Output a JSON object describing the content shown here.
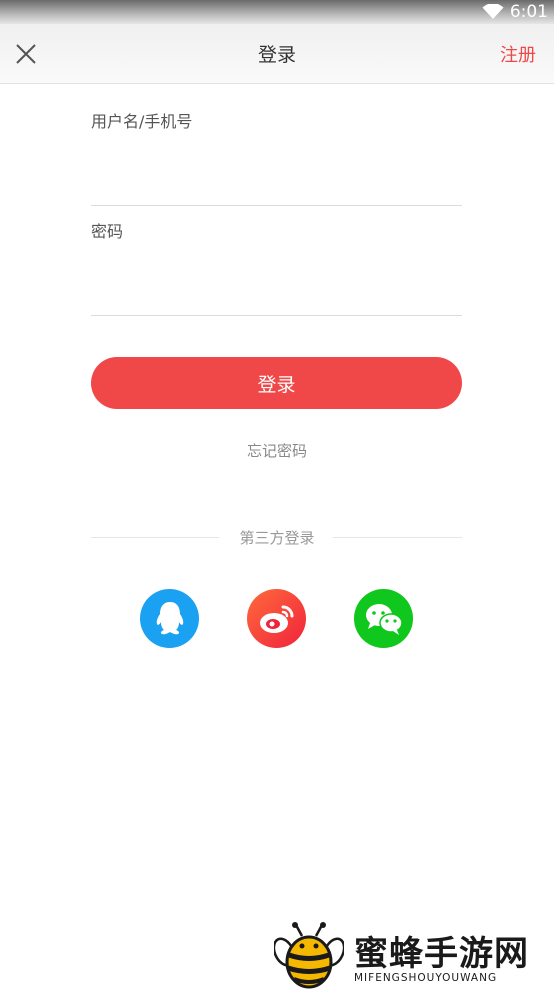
{
  "status_bar": {
    "time": "6:01",
    "wifi_icon": "wifi-icon"
  },
  "header": {
    "title": "登录",
    "register_label": "注册",
    "close_icon": "close-icon"
  },
  "form": {
    "username_label": "用户名/手机号",
    "username_value": "",
    "password_label": "密码",
    "password_value": "",
    "login_button": "登录",
    "forgot_password": "忘记密码"
  },
  "third_party": {
    "heading": "第三方登录",
    "providers": [
      {
        "name": "QQ",
        "icon": "qq-icon",
        "color": "#1ba1f2"
      },
      {
        "name": "Weibo",
        "icon": "weibo-icon",
        "color": "#f0233b"
      },
      {
        "name": "WeChat",
        "icon": "wechat-icon",
        "color": "#10c71d"
      }
    ]
  },
  "watermark": {
    "text": "蜜蜂手游网",
    "subtext": "MIFENGSHOUYOUWANG"
  },
  "colors": {
    "accent": "#f04848"
  }
}
